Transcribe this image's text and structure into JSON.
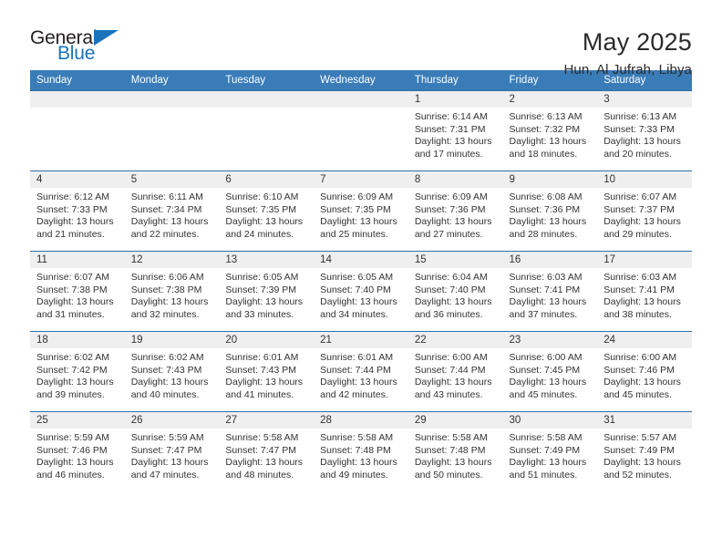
{
  "brand": {
    "name_part1": "General",
    "name_part2": "Blue",
    "accent_color": "#1a74bb"
  },
  "header": {
    "title": "May 2025",
    "location": "Hun, Al Jufrah, Libya"
  },
  "theme": {
    "header_row_color": "#3a7cb8",
    "day_strip_color": "#efefef",
    "row_border_color": "#2f6fa8"
  },
  "weekday_headers": [
    "Sunday",
    "Monday",
    "Tuesday",
    "Wednesday",
    "Thursday",
    "Friday",
    "Saturday"
  ],
  "labels": {
    "sunrise_prefix": "Sunrise: ",
    "sunset_prefix": "Sunset: ",
    "daylight_prefix": "Daylight: "
  },
  "weeks": [
    [
      {
        "blank": true
      },
      {
        "blank": true
      },
      {
        "blank": true
      },
      {
        "blank": true
      },
      {
        "day": "1",
        "sunrise": "Sunrise: 6:14 AM",
        "sunset": "Sunset: 7:31 PM",
        "daylight_1": "Daylight: 13 hours",
        "daylight_2": "and 17 minutes."
      },
      {
        "day": "2",
        "sunrise": "Sunrise: 6:13 AM",
        "sunset": "Sunset: 7:32 PM",
        "daylight_1": "Daylight: 13 hours",
        "daylight_2": "and 18 minutes."
      },
      {
        "day": "3",
        "sunrise": "Sunrise: 6:13 AM",
        "sunset": "Sunset: 7:33 PM",
        "daylight_1": "Daylight: 13 hours",
        "daylight_2": "and 20 minutes."
      }
    ],
    [
      {
        "day": "4",
        "sunrise": "Sunrise: 6:12 AM",
        "sunset": "Sunset: 7:33 PM",
        "daylight_1": "Daylight: 13 hours",
        "daylight_2": "and 21 minutes."
      },
      {
        "day": "5",
        "sunrise": "Sunrise: 6:11 AM",
        "sunset": "Sunset: 7:34 PM",
        "daylight_1": "Daylight: 13 hours",
        "daylight_2": "and 22 minutes."
      },
      {
        "day": "6",
        "sunrise": "Sunrise: 6:10 AM",
        "sunset": "Sunset: 7:35 PM",
        "daylight_1": "Daylight: 13 hours",
        "daylight_2": "and 24 minutes."
      },
      {
        "day": "7",
        "sunrise": "Sunrise: 6:09 AM",
        "sunset": "Sunset: 7:35 PM",
        "daylight_1": "Daylight: 13 hours",
        "daylight_2": "and 25 minutes."
      },
      {
        "day": "8",
        "sunrise": "Sunrise: 6:09 AM",
        "sunset": "Sunset: 7:36 PM",
        "daylight_1": "Daylight: 13 hours",
        "daylight_2": "and 27 minutes."
      },
      {
        "day": "9",
        "sunrise": "Sunrise: 6:08 AM",
        "sunset": "Sunset: 7:36 PM",
        "daylight_1": "Daylight: 13 hours",
        "daylight_2": "and 28 minutes."
      },
      {
        "day": "10",
        "sunrise": "Sunrise: 6:07 AM",
        "sunset": "Sunset: 7:37 PM",
        "daylight_1": "Daylight: 13 hours",
        "daylight_2": "and 29 minutes."
      }
    ],
    [
      {
        "day": "11",
        "sunrise": "Sunrise: 6:07 AM",
        "sunset": "Sunset: 7:38 PM",
        "daylight_1": "Daylight: 13 hours",
        "daylight_2": "and 31 minutes."
      },
      {
        "day": "12",
        "sunrise": "Sunrise: 6:06 AM",
        "sunset": "Sunset: 7:38 PM",
        "daylight_1": "Daylight: 13 hours",
        "daylight_2": "and 32 minutes."
      },
      {
        "day": "13",
        "sunrise": "Sunrise: 6:05 AM",
        "sunset": "Sunset: 7:39 PM",
        "daylight_1": "Daylight: 13 hours",
        "daylight_2": "and 33 minutes."
      },
      {
        "day": "14",
        "sunrise": "Sunrise: 6:05 AM",
        "sunset": "Sunset: 7:40 PM",
        "daylight_1": "Daylight: 13 hours",
        "daylight_2": "and 34 minutes."
      },
      {
        "day": "15",
        "sunrise": "Sunrise: 6:04 AM",
        "sunset": "Sunset: 7:40 PM",
        "daylight_1": "Daylight: 13 hours",
        "daylight_2": "and 36 minutes."
      },
      {
        "day": "16",
        "sunrise": "Sunrise: 6:03 AM",
        "sunset": "Sunset: 7:41 PM",
        "daylight_1": "Daylight: 13 hours",
        "daylight_2": "and 37 minutes."
      },
      {
        "day": "17",
        "sunrise": "Sunrise: 6:03 AM",
        "sunset": "Sunset: 7:41 PM",
        "daylight_1": "Daylight: 13 hours",
        "daylight_2": "and 38 minutes."
      }
    ],
    [
      {
        "day": "18",
        "sunrise": "Sunrise: 6:02 AM",
        "sunset": "Sunset: 7:42 PM",
        "daylight_1": "Daylight: 13 hours",
        "daylight_2": "and 39 minutes."
      },
      {
        "day": "19",
        "sunrise": "Sunrise: 6:02 AM",
        "sunset": "Sunset: 7:43 PM",
        "daylight_1": "Daylight: 13 hours",
        "daylight_2": "and 40 minutes."
      },
      {
        "day": "20",
        "sunrise": "Sunrise: 6:01 AM",
        "sunset": "Sunset: 7:43 PM",
        "daylight_1": "Daylight: 13 hours",
        "daylight_2": "and 41 minutes."
      },
      {
        "day": "21",
        "sunrise": "Sunrise: 6:01 AM",
        "sunset": "Sunset: 7:44 PM",
        "daylight_1": "Daylight: 13 hours",
        "daylight_2": "and 42 minutes."
      },
      {
        "day": "22",
        "sunrise": "Sunrise: 6:00 AM",
        "sunset": "Sunset: 7:44 PM",
        "daylight_1": "Daylight: 13 hours",
        "daylight_2": "and 43 minutes."
      },
      {
        "day": "23",
        "sunrise": "Sunrise: 6:00 AM",
        "sunset": "Sunset: 7:45 PM",
        "daylight_1": "Daylight: 13 hours",
        "daylight_2": "and 45 minutes."
      },
      {
        "day": "24",
        "sunrise": "Sunrise: 6:00 AM",
        "sunset": "Sunset: 7:46 PM",
        "daylight_1": "Daylight: 13 hours",
        "daylight_2": "and 45 minutes."
      }
    ],
    [
      {
        "day": "25",
        "sunrise": "Sunrise: 5:59 AM",
        "sunset": "Sunset: 7:46 PM",
        "daylight_1": "Daylight: 13 hours",
        "daylight_2": "and 46 minutes."
      },
      {
        "day": "26",
        "sunrise": "Sunrise: 5:59 AM",
        "sunset": "Sunset: 7:47 PM",
        "daylight_1": "Daylight: 13 hours",
        "daylight_2": "and 47 minutes."
      },
      {
        "day": "27",
        "sunrise": "Sunrise: 5:58 AM",
        "sunset": "Sunset: 7:47 PM",
        "daylight_1": "Daylight: 13 hours",
        "daylight_2": "and 48 minutes."
      },
      {
        "day": "28",
        "sunrise": "Sunrise: 5:58 AM",
        "sunset": "Sunset: 7:48 PM",
        "daylight_1": "Daylight: 13 hours",
        "daylight_2": "and 49 minutes."
      },
      {
        "day": "29",
        "sunrise": "Sunrise: 5:58 AM",
        "sunset": "Sunset: 7:48 PM",
        "daylight_1": "Daylight: 13 hours",
        "daylight_2": "and 50 minutes."
      },
      {
        "day": "30",
        "sunrise": "Sunrise: 5:58 AM",
        "sunset": "Sunset: 7:49 PM",
        "daylight_1": "Daylight: 13 hours",
        "daylight_2": "and 51 minutes."
      },
      {
        "day": "31",
        "sunrise": "Sunrise: 5:57 AM",
        "sunset": "Sunset: 7:49 PM",
        "daylight_1": "Daylight: 13 hours",
        "daylight_2": "and 52 minutes."
      }
    ]
  ]
}
